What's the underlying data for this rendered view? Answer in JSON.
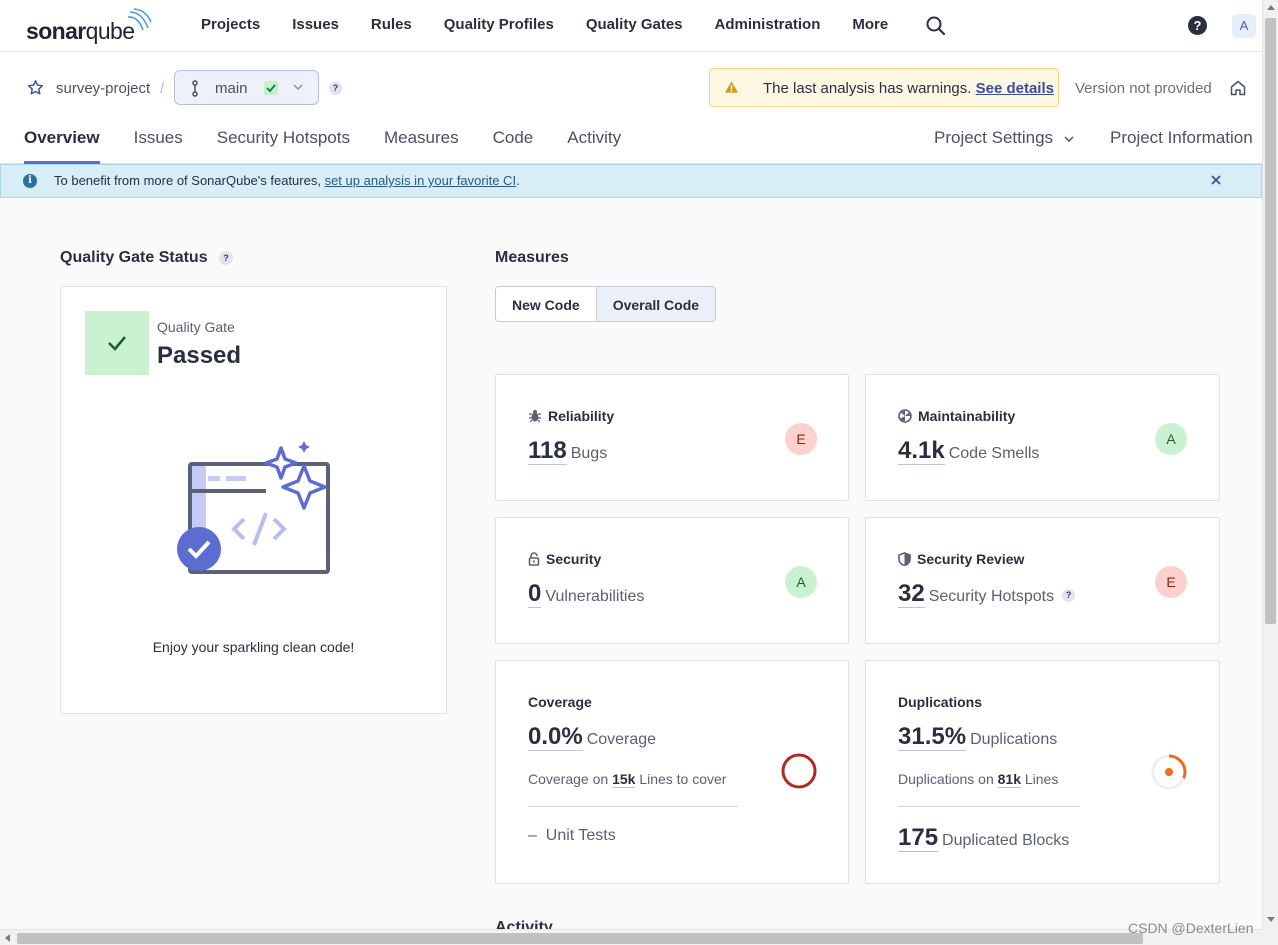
{
  "app": {
    "logo_prefix": "sonar",
    "logo_suffix": "qube",
    "nav": [
      "Projects",
      "Issues",
      "Rules",
      "Quality Profiles",
      "Quality Gates",
      "Administration",
      "More"
    ],
    "help": "?",
    "avatar": "A"
  },
  "project": {
    "name": "survey-project",
    "separator": "/",
    "branch": "main",
    "branch_help": "?",
    "warning_text": "The last analysis has warnings.",
    "warning_link": "See details",
    "version": "Version not provided",
    "tabs": [
      "Overview",
      "Issues",
      "Security Hotspots",
      "Measures",
      "Code",
      "Activity"
    ],
    "settings": "Project Settings",
    "information": "Project Information"
  },
  "banner": {
    "icon": "i",
    "text": "To benefit from more of SonarQube's features,",
    "link": "set up analysis in your favorite CI",
    "suffix": "."
  },
  "quality_gate": {
    "title": "Quality Gate Status",
    "help": "?",
    "label": "Quality Gate",
    "status": "Passed",
    "message": "Enjoy your sparkling clean code!"
  },
  "measures": {
    "title": "Measures",
    "toggle": [
      "New Code",
      "Overall Code"
    ],
    "reliability": {
      "title": "Reliability",
      "value": "118",
      "unit": "Bugs",
      "grade": "E"
    },
    "maintainability": {
      "title": "Maintainability",
      "value": "4.1k",
      "unit": "Code Smells",
      "grade": "A"
    },
    "security": {
      "title": "Security",
      "value": "0",
      "unit": "Vulnerabilities",
      "grade": "A"
    },
    "security_review": {
      "title": "Security Review",
      "value": "32",
      "unit": "Security Hotspots",
      "grade": "E",
      "help": "?"
    },
    "coverage": {
      "title": "Coverage",
      "value": "0.0%",
      "unit": "Coverage",
      "sub_prefix": "Coverage on",
      "sub_value": "15k",
      "sub_suffix": "Lines to cover",
      "unit_tests_value": "–",
      "unit_tests_label": "Unit Tests",
      "percent": 0
    },
    "duplications": {
      "title": "Duplications",
      "value": "31.5%",
      "unit": "Duplications",
      "sub_prefix": "Duplications on",
      "sub_value": "81k",
      "sub_suffix": "Lines",
      "blocks_value": "175",
      "blocks_label": "Duplicated Blocks",
      "percent": 31.5
    }
  },
  "activity_title": "Activity",
  "watermark": "CSDN @DexterLien",
  "colors": {
    "accent": "#5d6cd0",
    "passed": "#c9f2d3",
    "grade_bad": "#fcd0cd",
    "grade_good": "#c9f2d3",
    "coverage_ring": "#b02a22",
    "duplication_ring": "#ed6c1f"
  }
}
